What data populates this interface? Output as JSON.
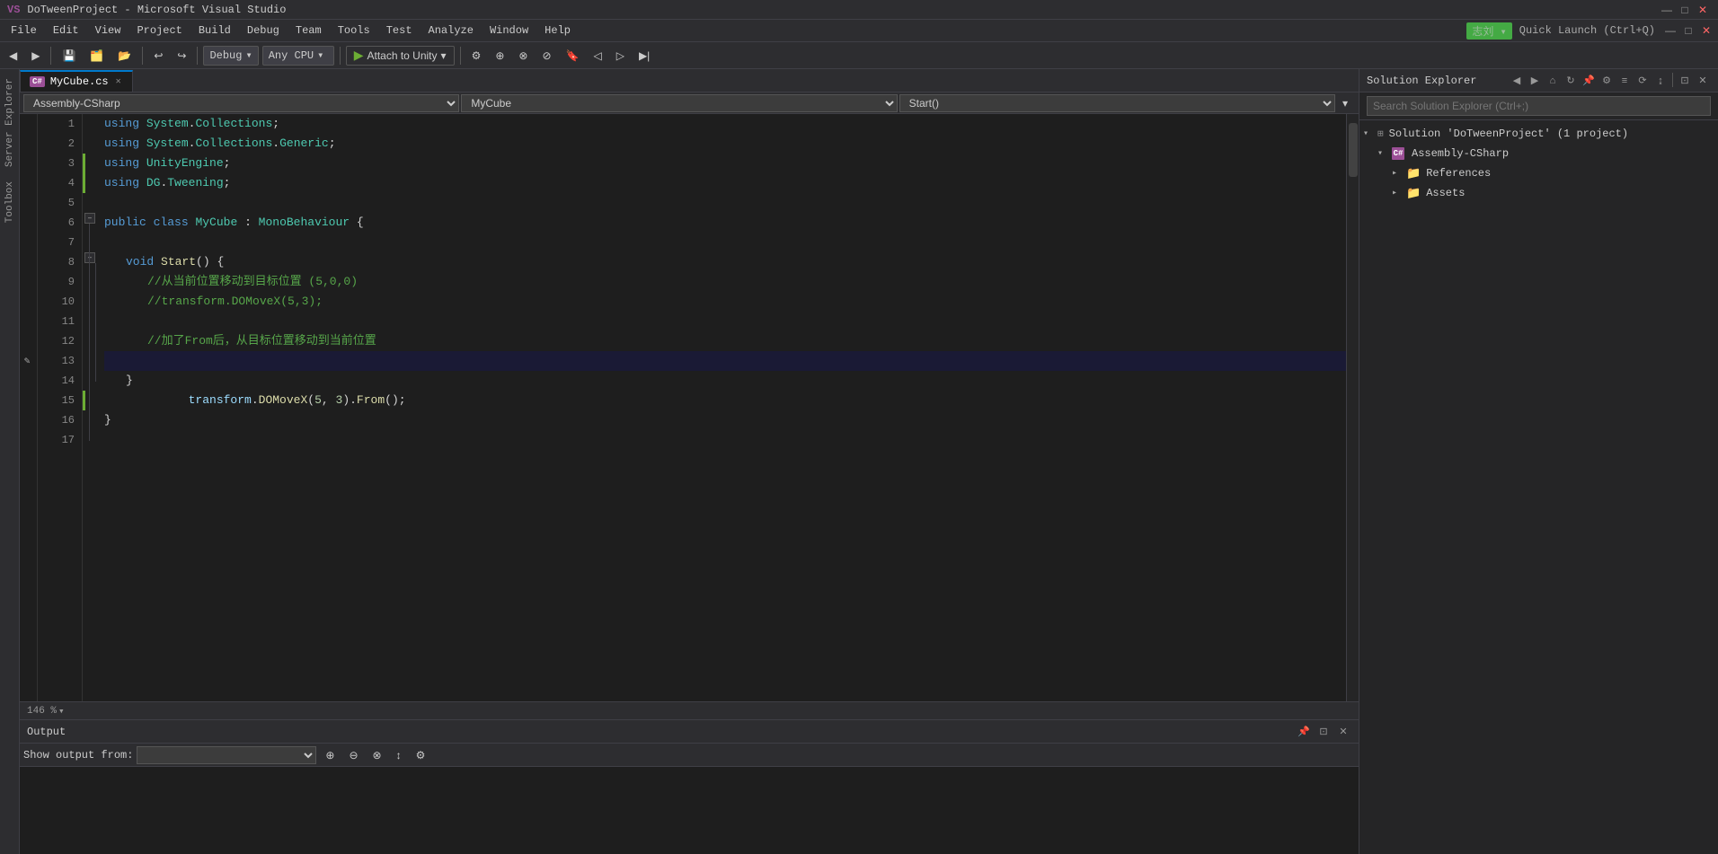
{
  "titlebar": {
    "text": "DoTweenProject - Microsoft Visual Studio"
  },
  "menu": {
    "items": [
      "File",
      "Edit",
      "View",
      "Project",
      "Build",
      "Debug",
      "Team",
      "Tools",
      "Test",
      "Analyze",
      "Window",
      "Help"
    ]
  },
  "toolbar": {
    "undo": "↩",
    "redo": "↪",
    "debug_mode": "Debug",
    "platform": "Any CPU",
    "attach_label": "Attach to Unity",
    "save_icon": "💾"
  },
  "tabs": [
    {
      "label": "MyCube.cs",
      "active": true,
      "icon": "C#"
    }
  ],
  "nav_bar": {
    "left": "Assembly-CSharp",
    "middle": "MyCube",
    "right": "Start()"
  },
  "code": {
    "lines": [
      {
        "num": 1,
        "indent": 0,
        "content": "using System.Collections;",
        "type": "using"
      },
      {
        "num": 2,
        "indent": 0,
        "content": "using System.Collections.Generic;",
        "type": "using"
      },
      {
        "num": 3,
        "indent": 0,
        "content": "using UnityEngine;",
        "type": "using"
      },
      {
        "num": 4,
        "indent": 0,
        "content": "using DG.Tweening;",
        "type": "using"
      },
      {
        "num": 5,
        "indent": 0,
        "content": "",
        "type": "empty"
      },
      {
        "num": 6,
        "indent": 0,
        "content": "public class MyCube : MonoBehaviour {",
        "type": "class"
      },
      {
        "num": 7,
        "indent": 1,
        "content": "",
        "type": "empty"
      },
      {
        "num": 8,
        "indent": 1,
        "content": "    void Start() {",
        "type": "method"
      },
      {
        "num": 9,
        "indent": 2,
        "content": "        //从当前位置移动到目标位置 (5,0,0)",
        "type": "comment"
      },
      {
        "num": 10,
        "indent": 2,
        "content": "        //transform.DOMoveX(5,3);",
        "type": "comment"
      },
      {
        "num": 11,
        "indent": 2,
        "content": "",
        "type": "empty"
      },
      {
        "num": 12,
        "indent": 2,
        "content": "        //加了From后，从目标位置移动到当前位置",
        "type": "comment"
      },
      {
        "num": 13,
        "indent": 2,
        "content": "        transform.DOMoveX(5, 3).From();",
        "type": "code",
        "active": true
      },
      {
        "num": 14,
        "indent": 1,
        "content": "    }",
        "type": "brace"
      },
      {
        "num": 15,
        "indent": 1,
        "content": "",
        "type": "empty"
      },
      {
        "num": 16,
        "indent": 0,
        "content": "}",
        "type": "brace"
      },
      {
        "num": 17,
        "indent": 0,
        "content": "",
        "type": "empty"
      }
    ]
  },
  "zoom": {
    "level": "146 %"
  },
  "solution_explorer": {
    "title": "Solution Explorer",
    "search_placeholder": "Search Solution Explorer (Ctrl+;)",
    "tree": {
      "solution": "Solution 'DoTweenProject' (1 project)",
      "project": "Assembly-CSharp",
      "references": "References",
      "assets": "Assets"
    }
  },
  "output": {
    "title": "Output",
    "show_output_label": "Show output from:",
    "dropdown_placeholder": ""
  },
  "left_sidebar": {
    "items": [
      "Server Explorer",
      "Toolbox"
    ]
  },
  "icons": {
    "play": "▶",
    "arrow_down": "▾",
    "arrow_right": "▸",
    "close": "✕",
    "pin": "📌",
    "search": "🔍",
    "collapse": "–",
    "expand": "+",
    "folder": "📁",
    "ref": "🔗"
  }
}
